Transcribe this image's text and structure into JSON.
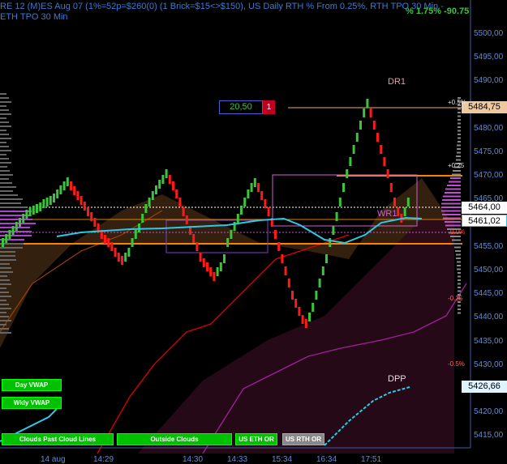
{
  "header": {
    "title_line1": "RE 12 (M)ES Aug 07 (1%=52p=$260(0) (1 Brick=$15<>$150), US Daily RTH % From 0.25%, RTH TPO 30 Min - ETH TPO 30 Min",
    "ratio": "% 1.75% -90.75"
  },
  "y_axis": {
    "ticks": [
      "5500,00",
      "5495,00",
      "5490,00",
      "5485,00",
      "5480,00",
      "5475,00",
      "5470,00",
      "5465,00",
      "5460,00",
      "5455,00",
      "5450,00",
      "5445,00",
      "5440,00",
      "5435,00",
      "5430,00",
      "5425,00",
      "5420,00",
      "5415,00"
    ]
  },
  "x_axis": {
    "ticks": [
      "14 aug",
      "14:29",
      "14:30",
      "14:33",
      "15:34",
      "16:34",
      "17:51"
    ]
  },
  "price_tags": {
    "dr1": "5484,75",
    "close": "5464,00",
    "last": "5461,02",
    "dpp": "5426,66"
  },
  "level_labels": {
    "dr1": "DR1",
    "wr1": "WR1",
    "dpp": "DPP"
  },
  "pct_labels": {
    "p05": "+0.5%",
    "p025": "+0.25",
    "m025": "-0.25",
    "m05": "-0.5%",
    "mid": "0.0%"
  },
  "counter": {
    "value": "20,50",
    "badge": "1"
  },
  "buttons": {
    "day_vwap": "Day VWAP",
    "wkly_vwap": "Wkly VWAP",
    "past_cloud": "Clouds Past Cloud Lines",
    "outside_clouds": "Outside Clouds",
    "us_eth_or": "US ETH OR",
    "us_rth_or": "US RTH OR"
  },
  "colors": {
    "up": "#3cc43c",
    "down": "#ff1a1a",
    "vwap": "#2ec8e6",
    "axis_text": "#5a8de0"
  }
}
